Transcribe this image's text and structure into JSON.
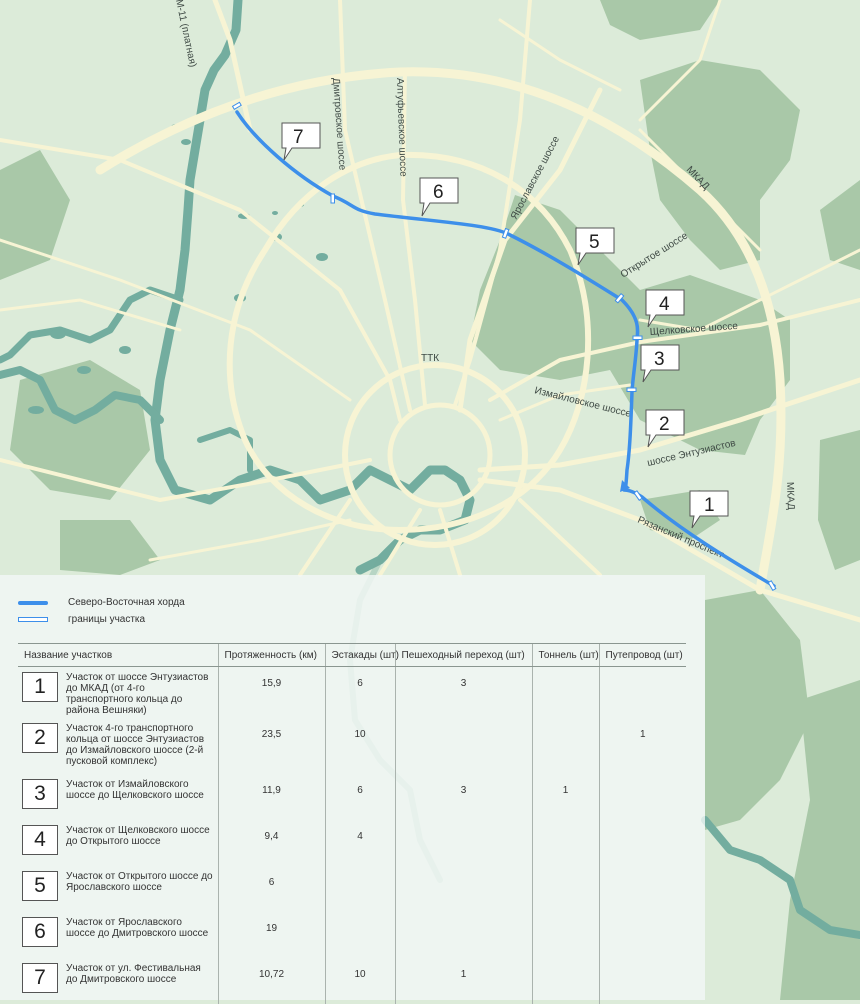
{
  "map": {
    "labels": {
      "m11": "М-11 (платная)",
      "dmitrovskoe": "Дмитровское шоссе",
      "altufevskoe": "Алтуфьевское шоссе",
      "yaroslavskoe": "Ярославское шоссе",
      "mkad_top": "МКАД",
      "mkad_right": "МКАД",
      "otkrytoe": "Открытое шоссе",
      "shchelkovskoe": "Щелковское шоссе",
      "ttk": "ТТК",
      "izmaylovskoe": "Измайловское шоссе",
      "entuziastov": "шоссе Энтузиастов",
      "ryazansky": "Рязанский проспект"
    },
    "section_markers": [
      "7",
      "6",
      "5",
      "4",
      "3",
      "2",
      "1"
    ],
    "colors": {
      "background": "#dcebd9",
      "forest": "#a9c8a8",
      "road": "#f7f4d4",
      "water": "#73ad9f",
      "route": "#3d8fea"
    }
  },
  "legend": {
    "route_label": "Северо-Восточная хорда",
    "border_label": "границы участка"
  },
  "table": {
    "headers": [
      "Название участков",
      "Протяженность (км)",
      "Эстакады (шт)",
      "Пешеходный переход (шт)",
      "Тоннель (шт)",
      "Путепровод (шт)"
    ],
    "rows": [
      {
        "num": "1",
        "name": "Участок от шоссе Энтузиастов до МКАД (от 4-го транспортного кольца до района Вешняки)",
        "length": "15,9",
        "overpasses": "6",
        "pedestrian": "3",
        "tunnel": "",
        "bridge": ""
      },
      {
        "num": "2",
        "name": "Участок 4-го транспортного кольца от шоссе Энтузиастов до Измайловского шоссе (2-й пусковой комплекс)",
        "length": "23,5",
        "overpasses": "10",
        "pedestrian": "",
        "tunnel": "",
        "bridge": "1"
      },
      {
        "num": "3",
        "name": "Участок от Измайловского шоссе до Щелковского шоссе",
        "length": "11,9",
        "overpasses": "6",
        "pedestrian": "3",
        "tunnel": "1",
        "bridge": ""
      },
      {
        "num": "4",
        "name": "Участок от Щелковского шоссе до Открытого шоссе",
        "length": "9,4",
        "overpasses": "4",
        "pedestrian": "",
        "tunnel": "",
        "bridge": ""
      },
      {
        "num": "5",
        "name": "Участок от Открытого шоссе до Ярославского шоссе",
        "length": "6",
        "overpasses": "",
        "pedestrian": "",
        "tunnel": "",
        "bridge": ""
      },
      {
        "num": "6",
        "name": "Участок от Ярославского шоссе до Дмитровского шоссе",
        "length": "19",
        "overpasses": "",
        "pedestrian": "",
        "tunnel": "",
        "bridge": ""
      },
      {
        "num": "7",
        "name": "Участок от ул. Фестивальная до Дмитровского шоссе",
        "length": "10,72",
        "overpasses": "10",
        "pedestrian": "1",
        "tunnel": "",
        "bridge": ""
      }
    ]
  }
}
